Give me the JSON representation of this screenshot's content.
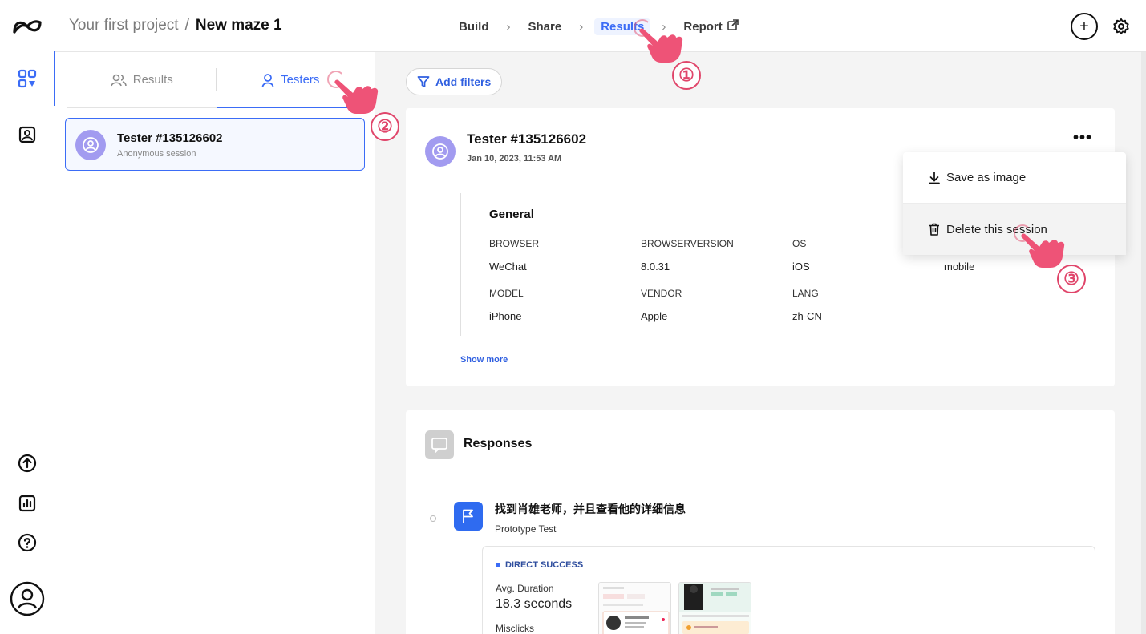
{
  "topbar": {
    "project": "Your first project",
    "separator": "/",
    "maze_name": "New maze 1",
    "steps": [
      "Build",
      "Share",
      "Results",
      "Report"
    ],
    "active_step": "Results"
  },
  "left_panel": {
    "tabs": [
      "Results",
      "Testers"
    ],
    "active_tab": "Testers",
    "tester": {
      "name": "Tester #135126602",
      "subtitle": "Anonymous session"
    }
  },
  "main": {
    "filter_label": "Add filters",
    "session": {
      "title": "Tester #135126602",
      "date": "Jan 10, 2023, 11:53 AM",
      "more_label": "•••",
      "general_title": "General",
      "fields_row1": [
        {
          "key": "BROWSER",
          "value": "WeChat"
        },
        {
          "key": "BROWSERVERSION",
          "value": "8.0.31"
        },
        {
          "key": "OS",
          "value": "iOS"
        },
        {
          "key": "",
          "value": "mobile"
        }
      ],
      "fields_row2": [
        {
          "key": "MODEL",
          "value": "iPhone"
        },
        {
          "key": "VENDOR",
          "value": "Apple"
        },
        {
          "key": "LANG",
          "value": "zh-CN"
        }
      ],
      "show_more": "Show more"
    },
    "menu": {
      "save_image": "Save as image",
      "delete_session": "Delete this session"
    },
    "responses": {
      "title": "Responses",
      "task_title": "找到肖雄老师，并且查看他的详细信息",
      "task_type": "Prototype Test",
      "status": "DIRECT SUCCESS",
      "avg_duration_label": "Avg. Duration",
      "avg_duration_value": "18.3 seconds",
      "misclicks_label": "Misclicks"
    }
  },
  "annotations": [
    "①",
    "②",
    "③"
  ],
  "colors": {
    "accent": "#3b6cf6",
    "annotation": "#e0456a",
    "avatar": "#a29bf0"
  }
}
